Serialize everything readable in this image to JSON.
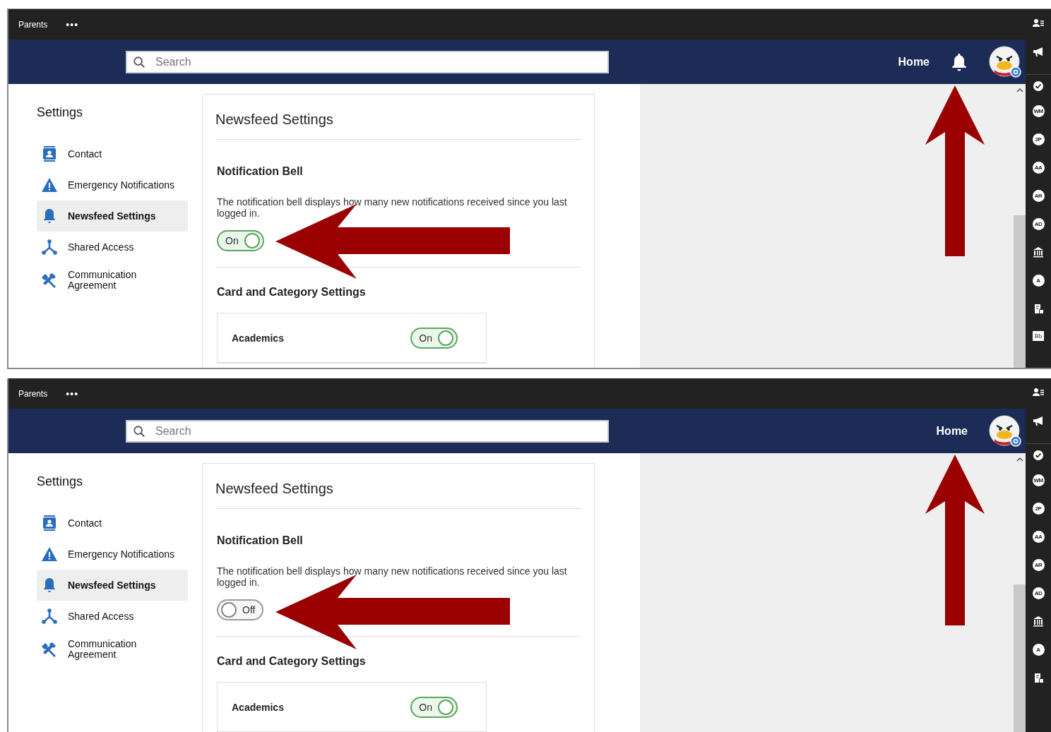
{
  "panels": [
    {
      "top_bar": {
        "title": "Parents",
        "more": "•••"
      },
      "search": {
        "placeholder": "Search"
      },
      "header": {
        "home": "Home",
        "bell": true
      },
      "sidebar": {
        "title": "Settings",
        "items": [
          {
            "label": "Contact",
            "selected": false
          },
          {
            "label": "Emergency Notifications",
            "selected": false
          },
          {
            "label": "Newsfeed Settings",
            "selected": true
          },
          {
            "label": "Shared Access",
            "selected": false
          },
          {
            "label": "Communication Agreement",
            "selected": false
          }
        ]
      },
      "content": {
        "title": "Newsfeed Settings",
        "bell_section": {
          "title": "Notification Bell",
          "description": "The notification bell displays how many new notifications received since you last logged in.",
          "toggle": {
            "label": "On",
            "on": true
          }
        },
        "cards_section": {
          "title": "Card and Category Settings",
          "rows": [
            {
              "label": "Academics",
              "toggle": {
                "label": "On",
                "on": true
              }
            }
          ]
        }
      },
      "rail": [
        {
          "kind": "icon"
        },
        {
          "kind": "icon"
        },
        {
          "kind": "icon"
        },
        {
          "kind": "badge",
          "text": "WM"
        },
        {
          "kind": "badge",
          "text": "2P"
        },
        {
          "kind": "badge",
          "text": "AA"
        },
        {
          "kind": "badge",
          "text": "AR"
        },
        {
          "kind": "badge",
          "text": "AD"
        },
        {
          "kind": "icon"
        },
        {
          "kind": "badge",
          "text": "A"
        },
        {
          "kind": "icon"
        },
        {
          "kind": "tile",
          "text": "Bb"
        }
      ]
    },
    {
      "top_bar": {
        "title": "Parents",
        "more": "•••"
      },
      "search": {
        "placeholder": "Search"
      },
      "header": {
        "home": "Home",
        "bell": false
      },
      "sidebar": {
        "title": "Settings",
        "items": [
          {
            "label": "Contact",
            "selected": false
          },
          {
            "label": "Emergency Notifications",
            "selected": false
          },
          {
            "label": "Newsfeed Settings",
            "selected": true
          },
          {
            "label": "Shared Access",
            "selected": false
          },
          {
            "label": "Communication Agreement",
            "selected": false
          }
        ]
      },
      "content": {
        "title": "Newsfeed Settings",
        "bell_section": {
          "title": "Notification Bell",
          "description": "The notification bell displays how many new notifications received since you last logged in.",
          "toggle": {
            "label": "Off",
            "on": false
          }
        },
        "cards_section": {
          "title": "Card and Category Settings",
          "rows": [
            {
              "label": "Academics",
              "toggle": {
                "label": "On",
                "on": true
              }
            }
          ]
        }
      },
      "rail": [
        {
          "kind": "icon"
        },
        {
          "kind": "icon"
        },
        {
          "kind": "icon"
        },
        {
          "kind": "badge",
          "text": "WM"
        },
        {
          "kind": "badge",
          "text": "2P"
        },
        {
          "kind": "badge",
          "text": "AA"
        },
        {
          "kind": "badge",
          "text": "AR"
        },
        {
          "kind": "badge",
          "text": "AD"
        },
        {
          "kind": "icon"
        },
        {
          "kind": "badge",
          "text": "A"
        },
        {
          "kind": "icon"
        }
      ]
    }
  ]
}
